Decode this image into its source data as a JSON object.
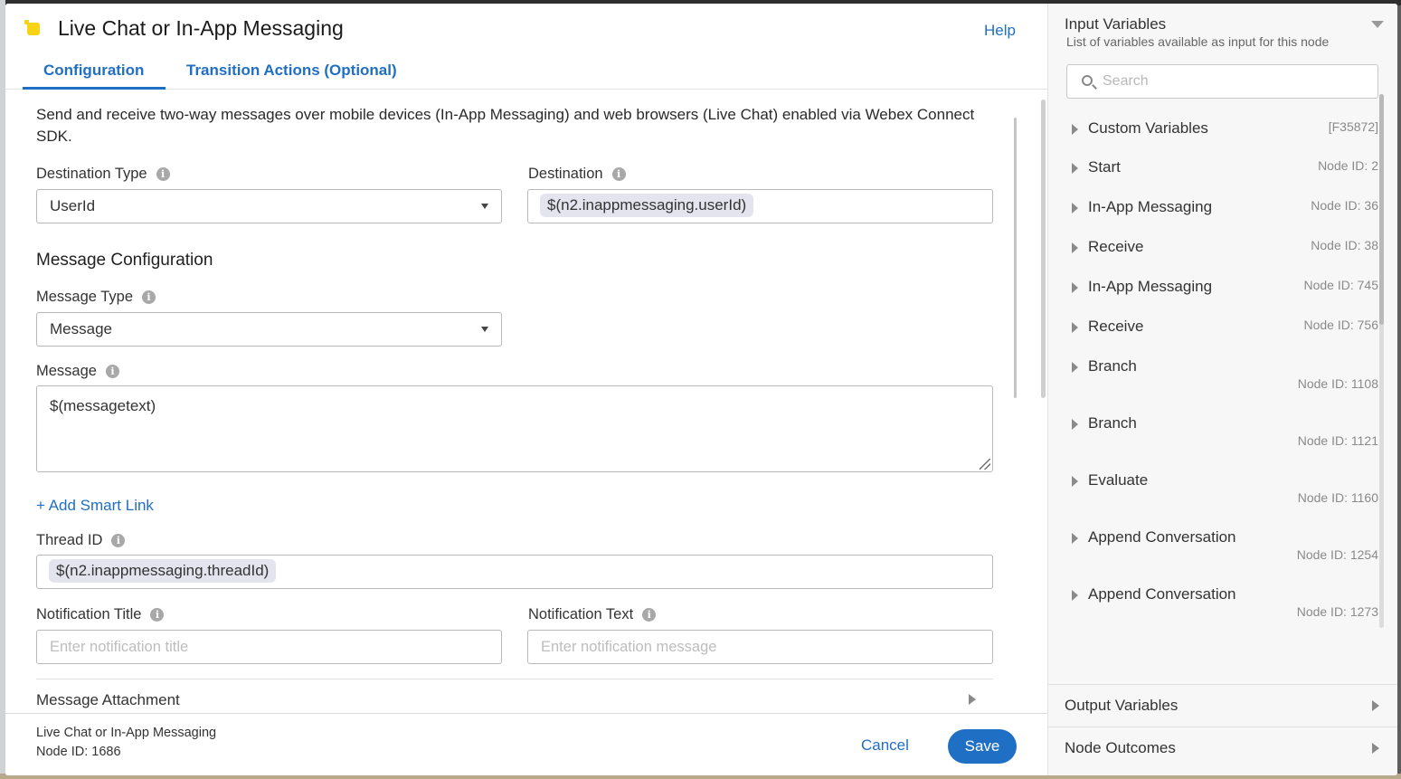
{
  "window": {
    "title": "Live Chat or In-App Messaging",
    "help": "Help"
  },
  "tabs": [
    {
      "label": "Configuration",
      "active": true
    },
    {
      "label": "Transition Actions (Optional)",
      "active": false
    }
  ],
  "form": {
    "description": "Send and receive two-way messages over mobile devices (In-App Messaging) and web browsers (Live Chat) enabled via Webex Connect SDK.",
    "destination_type": {
      "label": "Destination Type",
      "value": "UserId"
    },
    "destination": {
      "label": "Destination",
      "value": "$(n2.inappmessaging.userId)"
    },
    "message_configuration": "Message Configuration",
    "message_type": {
      "label": "Message Type",
      "value": "Message"
    },
    "message": {
      "label": "Message",
      "value": "$(messagetext)"
    },
    "add_smart_link": "+ Add Smart Link",
    "thread_id": {
      "label": "Thread ID",
      "value": "$(n2.inappmessaging.threadId)"
    },
    "notification_title": {
      "label": "Notification Title",
      "placeholder": "Enter notification title"
    },
    "notification_text": {
      "label": "Notification Text",
      "placeholder": "Enter notification message"
    },
    "message_attachment": "Message Attachment"
  },
  "footer": {
    "node_name": "Live Chat or In-App Messaging",
    "node_id": "Node ID: 1686",
    "cancel": "Cancel",
    "save": "Save"
  },
  "right_panel": {
    "title": "Input Variables",
    "subtitle": "List of variables available as input for this node",
    "search_placeholder": "Search",
    "items": [
      {
        "name": "Custom Variables",
        "node_id": "[F35872]"
      },
      {
        "name": "Start",
        "node_id": "Node ID: 2"
      },
      {
        "name": "In-App Messaging",
        "node_id": "Node ID: 36"
      },
      {
        "name": "Receive",
        "node_id": "Node ID: 38"
      },
      {
        "name": "In-App Messaging",
        "node_id": "Node ID: 745"
      },
      {
        "name": "Receive",
        "node_id": "Node ID: 756"
      },
      {
        "name": "Branch",
        "node_id": "Node ID: 1108"
      },
      {
        "name": "Branch",
        "node_id": "Node ID: 1121"
      },
      {
        "name": "Evaluate",
        "node_id": "Node ID: 1160"
      },
      {
        "name": "Append Conversation",
        "node_id": "Node ID: 1254"
      },
      {
        "name": "Append Conversation",
        "node_id": "Node ID: 1273"
      }
    ],
    "output_variables": "Output Variables",
    "node_outcomes": "Node Outcomes"
  },
  "colors": {
    "accent": "#1f6fc5",
    "node_icon": "#f7d313"
  }
}
